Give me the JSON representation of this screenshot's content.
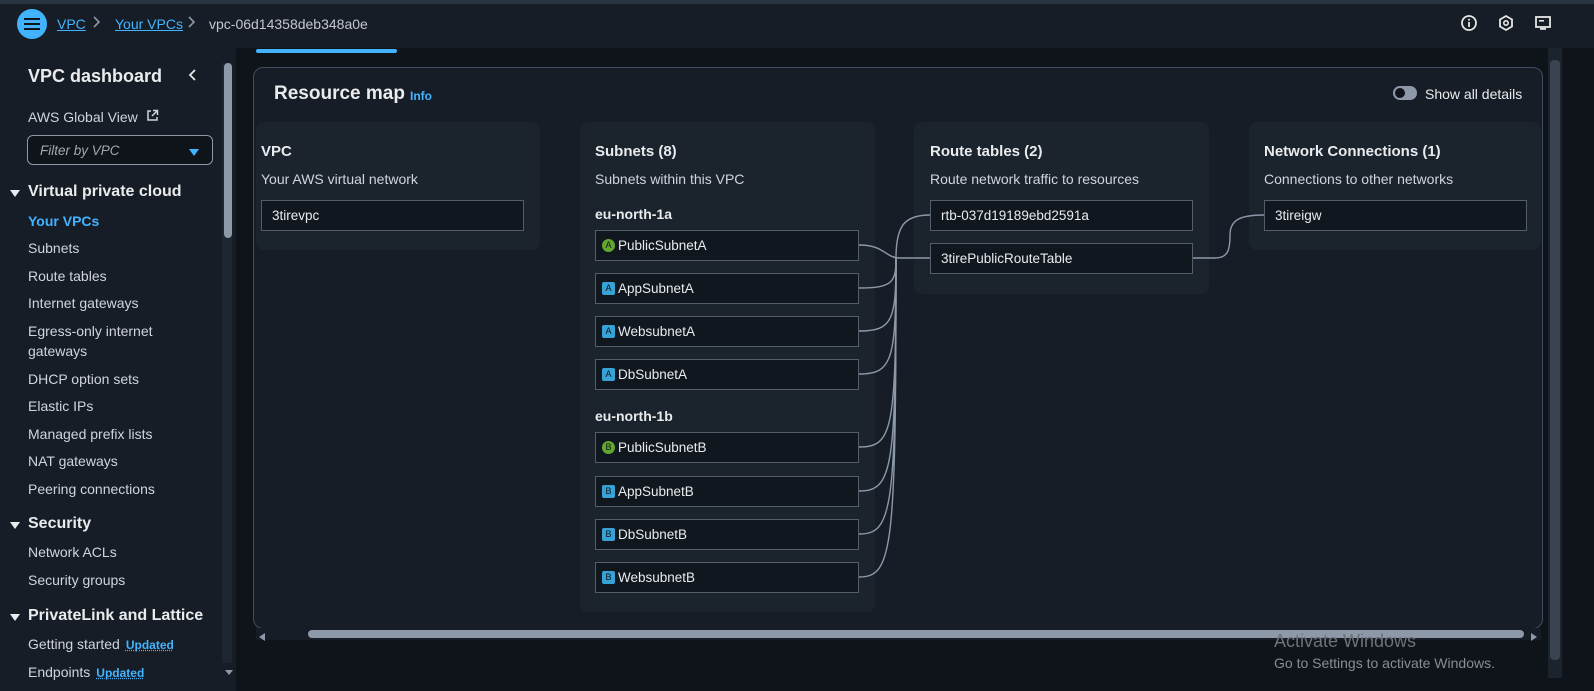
{
  "breadcrumb": {
    "vpc": "VPC",
    "your_vpcs": "Your VPCs",
    "current": "vpc-06d14358deb348a0e"
  },
  "sidebar": {
    "title": "VPC dashboard",
    "global_view": "AWS Global View",
    "filter_placeholder": "Filter by VPC",
    "sections": [
      {
        "label": "Virtual private cloud",
        "items": [
          "Your VPCs",
          "Subnets",
          "Route tables",
          "Internet gateways",
          "Egress-only internet",
          "gateways",
          "DHCP option sets",
          "Elastic IPs",
          "Managed prefix lists",
          "NAT gateways",
          "Peering connections"
        ]
      },
      {
        "label": "Security",
        "items": [
          "Network ACLs",
          "Security groups"
        ]
      },
      {
        "label": "PrivateLink and Lattice",
        "items": [
          "Getting started",
          "Endpoints"
        ]
      }
    ],
    "updated_label": "Updated",
    "active_item": "Your VPCs"
  },
  "resource_map": {
    "title": "Resource map",
    "info": "Info",
    "toggle_label": "Show all details",
    "vpc": {
      "header": "VPC",
      "sub": "Your AWS virtual network",
      "name": "3tirevpc"
    },
    "subnets": {
      "header": "Subnets (8)",
      "sub": "Subnets within this VPC",
      "zones": [
        {
          "name": "eu-north-1a",
          "subnets": [
            {
              "badge": "A",
              "kind": "public",
              "name": "PublicSubnetA"
            },
            {
              "badge": "A",
              "kind": "private",
              "name": "AppSubnetA"
            },
            {
              "badge": "A",
              "kind": "private",
              "name": "WebsubnetA"
            },
            {
              "badge": "A",
              "kind": "private",
              "name": "DbSubnetA"
            }
          ]
        },
        {
          "name": "eu-north-1b",
          "subnets": [
            {
              "badge": "B",
              "kind": "public",
              "name": "PublicSubnetB"
            },
            {
              "badge": "B",
              "kind": "private",
              "name": "AppSubnetB"
            },
            {
              "badge": "B",
              "kind": "private",
              "name": "DbSubnetB"
            },
            {
              "badge": "B",
              "kind": "private",
              "name": "WebsubnetB"
            }
          ]
        }
      ]
    },
    "route_tables": {
      "header": "Route tables (2)",
      "sub": "Route network traffic to resources",
      "items": [
        "rtb-037d19189ebd2591a",
        "3tirePublicRouteTable"
      ]
    },
    "network": {
      "header": "Network Connections (1)",
      "sub": "Connections to other networks",
      "items": [
        "3tireigw"
      ]
    }
  },
  "watermark": {
    "line1": "Activate Windows",
    "line2": "Go to Settings to activate Windows."
  },
  "colors": {
    "accent": "#42b4ff",
    "public_badge": "#62a82e",
    "private_badge": "#36a2d6"
  }
}
